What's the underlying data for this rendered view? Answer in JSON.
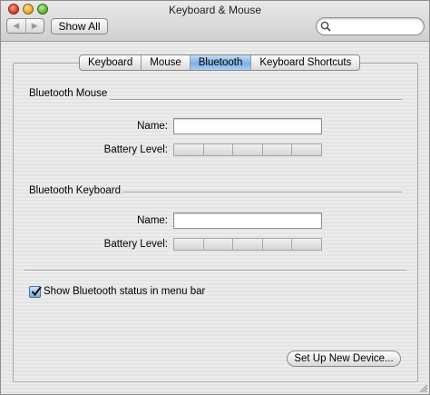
{
  "window": {
    "title": "Keyboard & Mouse"
  },
  "toolbar": {
    "back_icon": "back-arrow-icon",
    "forward_icon": "forward-arrow-icon",
    "show_all_label": "Show All",
    "search_value": ""
  },
  "tabs": [
    {
      "label": "Keyboard",
      "active": false
    },
    {
      "label": "Mouse",
      "active": false
    },
    {
      "label": "Bluetooth",
      "active": true
    },
    {
      "label": "Keyboard Shortcuts",
      "active": false
    }
  ],
  "bluetooth_mouse": {
    "section_title": "Bluetooth Mouse",
    "name_label": "Name:",
    "name_value": "",
    "battery_label": "Battery Level:",
    "battery_level": 0
  },
  "bluetooth_keyboard": {
    "section_title": "Bluetooth Keyboard",
    "name_label": "Name:",
    "name_value": "",
    "battery_label": "Battery Level:",
    "battery_level": 0
  },
  "status_checkbox": {
    "label": "Show Bluetooth status in menu bar",
    "checked": true
  },
  "setup_button_label": "Set Up New Device..."
}
